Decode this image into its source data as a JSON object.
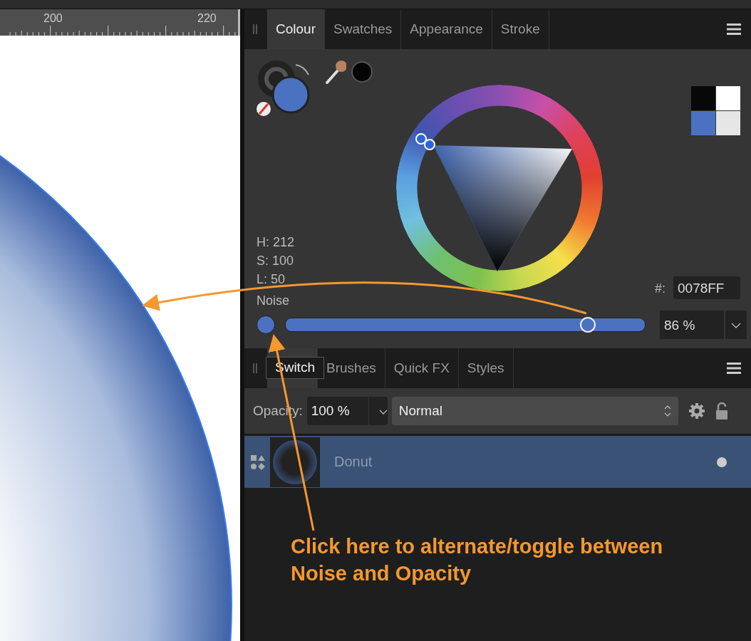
{
  "ruler": {
    "labels": [
      "200",
      "220"
    ]
  },
  "colour_panel": {
    "tabs": [
      {
        "label": "Colour",
        "selected": true
      },
      {
        "label": "Swatches",
        "selected": false
      },
      {
        "label": "Appearance",
        "selected": false
      },
      {
        "label": "Stroke",
        "selected": false
      }
    ],
    "hsl": [
      "H: 212",
      "S: 100",
      "L: 50"
    ],
    "hex_label": "#:",
    "hex_value": "0078FF",
    "noise_label": "Noise",
    "noise": {
      "level": 0.84
    },
    "noise_value": "86 %"
  },
  "layers_panel": {
    "tabs": [
      {
        "tooltip": "Switch",
        "selected": true
      },
      {
        "label": "Brushes",
        "selected": false
      },
      {
        "label": "Quick FX",
        "selected": false
      },
      {
        "label": "Styles",
        "selected": false
      }
    ],
    "opacity_label": "Opacity:",
    "opacity_value": "100 %",
    "blend_mode": "Normal",
    "layers": [
      {
        "name": "Donut",
        "selected": true,
        "visible": true
      }
    ]
  },
  "annotation": {
    "caption": "Click here to alternate/toggle between Noise and Opacity"
  }
}
